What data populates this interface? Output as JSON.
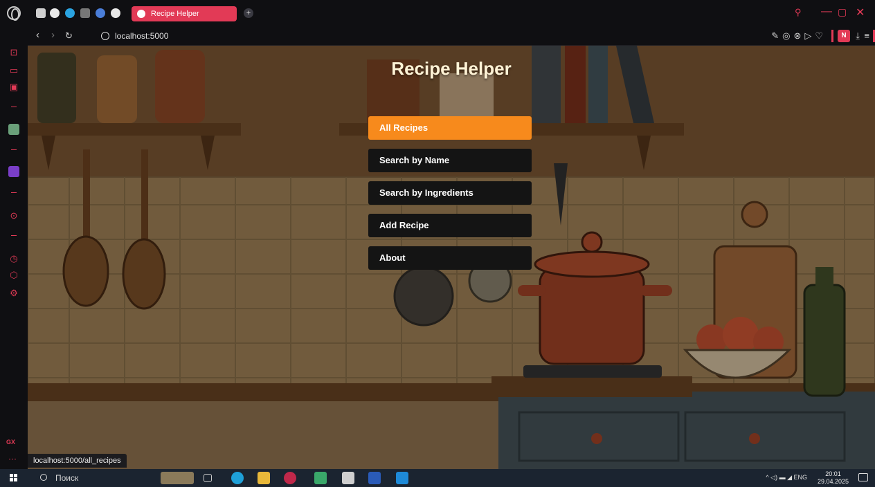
{
  "browser": {
    "tab_title": "Recipe Helper",
    "new_tab_symbol": "+",
    "url": "localhost:5000",
    "profile_initial": "N",
    "status_url": "localhost:5000/all_recipes",
    "sidebar_gx": "GX",
    "sidebar_more": "···",
    "accent_color": "#e23a56"
  },
  "page": {
    "title": "Recipe Helper",
    "menu": [
      {
        "label": "All Recipes",
        "active": true
      },
      {
        "label": "Search by Name",
        "active": false
      },
      {
        "label": "Search by Ingredients",
        "active": false
      },
      {
        "label": "Add Recipe",
        "active": false
      },
      {
        "label": "About",
        "active": false
      }
    ],
    "active_color": "#f78a1c",
    "button_color": "#141414"
  },
  "taskbar": {
    "search_placeholder": "Поиск",
    "language": "ENG",
    "time": "20:01",
    "date": "29.04.2025"
  }
}
